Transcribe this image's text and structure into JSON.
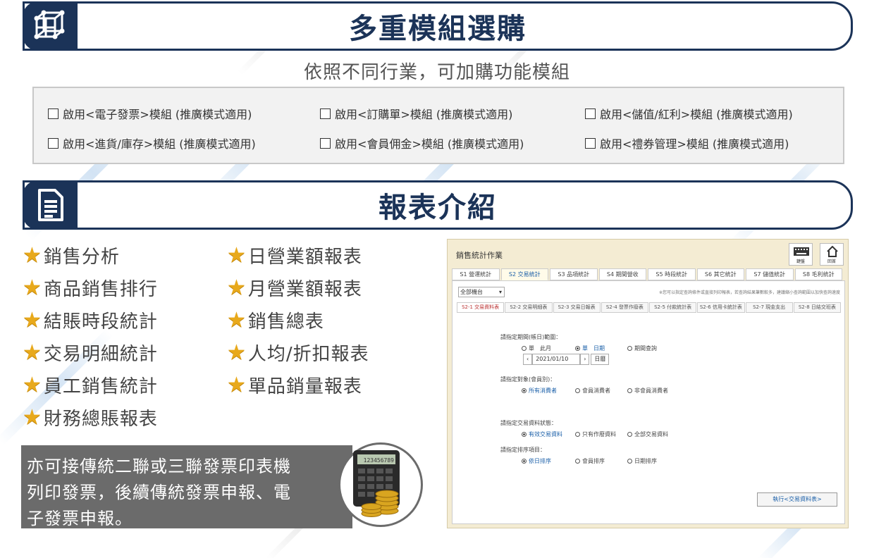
{
  "header1": {
    "title": "多重模組選購",
    "subtitle": "依照不同行業，可加購功能模組"
  },
  "modules": [
    "啟用<電子發票>模組 (推廣模式適用)",
    "啟用<訂購單>模組 (推廣模式適用)",
    "啟用<儲值/紅利>模組 (推廣模式適用)",
    "啟用<進貨/庫存>模組 (推廣模式適用)",
    "啟用<會員佣金>模組 (推廣模式適用)",
    "啟用<禮券管理>模組 (推廣模式適用)"
  ],
  "header2": {
    "title": "報表介紹"
  },
  "reports_left": [
    "銷售分析",
    "商品銷售排行",
    "結賬時段統計",
    "交易明細統計",
    "員工銷售統計",
    "財務總賬報表"
  ],
  "reports_right": [
    "日營業額報表",
    "月營業額報表",
    "銷售總表",
    "人均/折扣報表",
    "單品銷量報表"
  ],
  "note": {
    "line1": "亦可接傳統二聯或三聯發票印表機",
    "line2": "列印發票，後續傳統發票申報、電",
    "line3": "子發票申報。"
  },
  "calculator": {
    "display": "123456789"
  },
  "screenshot": {
    "title": "銷售統計作業",
    "btn_keyboard": "鍵盤",
    "btn_home": "回首",
    "tabs": [
      "S1 營運統計",
      "S2 交易統計",
      "S3 品項統計",
      "S4 期間營收",
      "S5 時段統計",
      "S6 其它統計",
      "S7 儲值統計",
      "S8 毛利統計"
    ],
    "active_tab": 1,
    "select_value": "全部機台",
    "top_note": "※您可以指定查詢條件或直接列印報表，若查詢結果筆數較多，建議縮小查詢範圍以加快查詢速度",
    "subtabs": [
      "S2-1 交易資料表",
      "S2-2 交易明細表",
      "S2-3 交易日報表",
      "S2-4 發票作廢表",
      "S2-5 付款統計表",
      "S2-6 信用卡統計表",
      "S2-7 現金支出",
      "S2-8 日結交班表"
    ],
    "active_subtab": 0,
    "q1_label": "請指定期間(帳日)範圍：",
    "q1_options": [
      "單　此月",
      "單　日期",
      "期間查詢"
    ],
    "date_value": "2021/01/10",
    "date_btn": "日曆",
    "q2_label": "請指定對象(會員別)：",
    "q2_options": [
      "所有消費者",
      "會員消費者",
      "非會員消費者"
    ],
    "q3_label": "請指定交易資料狀態：",
    "q3_options": [
      "有效交易資料",
      "只有作廢資料",
      "全部交易資料"
    ],
    "q4_label": "請指定排序項目：",
    "q4_options": [
      "依日排序",
      "會員排序",
      "日期排序"
    ],
    "exec_label": "執行<交易資料表>"
  }
}
